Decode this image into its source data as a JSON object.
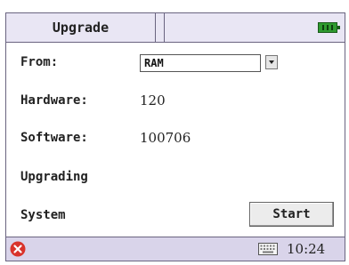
{
  "header": {
    "title": "Upgrade"
  },
  "form": {
    "from_label": "From:",
    "from_value": "RAM",
    "hardware_label": "Hardware:",
    "hardware_value": "120",
    "software_label": "Software:",
    "software_value": "100706",
    "upgrading_label": "Upgrading",
    "system_label": "System",
    "start_label": "Start"
  },
  "statusbar": {
    "time": "10:24"
  },
  "icons": {
    "battery": "battery-icon",
    "close": "close-icon",
    "keyboard": "keyboard-icon"
  },
  "colors": {
    "title_bg": "#e9e6f4",
    "status_bg": "#d9d4ea",
    "battery": "#2f9a2f",
    "close": "#d9332b"
  }
}
